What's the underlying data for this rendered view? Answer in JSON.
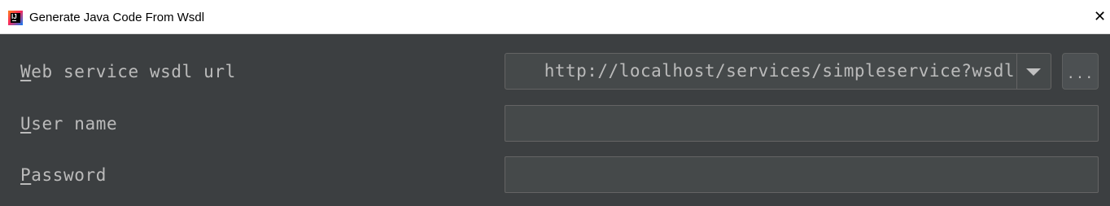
{
  "window": {
    "title": "Generate Java Code From Wsdl",
    "close_glyph": "✕",
    "app_icon": "intellij-idea-icon",
    "app_icon_text": "IJ"
  },
  "form": {
    "wsdl_url": {
      "label_mnemonic": "W",
      "label_rest": "eb service wsdl url",
      "value": "http://localhost/services/simpleservice?wsdl",
      "dropdown_icon": "chevron-down-icon",
      "browse_label": "..."
    },
    "user_name": {
      "label_mnemonic": "U",
      "label_rest": "ser name",
      "value": ""
    },
    "password": {
      "label_mnemonic": "P",
      "label_rest": "assword",
      "value": ""
    }
  },
  "colors": {
    "background": "#3c3f41",
    "field_background": "#45494a",
    "text": "#bbbbbb",
    "border": "#646464"
  }
}
